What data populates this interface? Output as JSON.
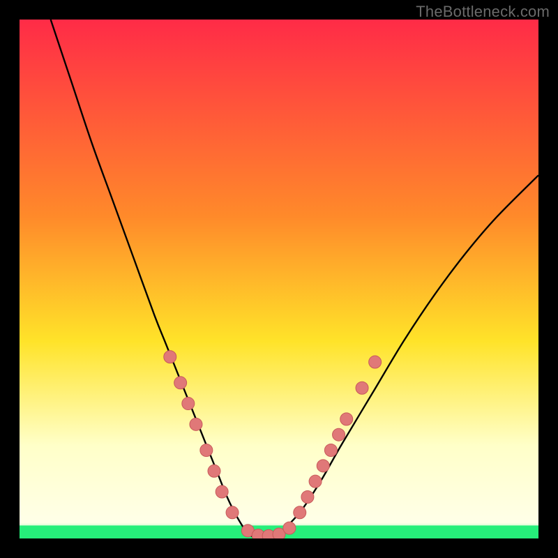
{
  "watermark": "TheBottleneck.com",
  "colors": {
    "frame": "#000000",
    "curve": "#000000",
    "dot_fill": "#e07878",
    "dot_stroke": "#c75a5a",
    "green_band": "#26ef7a",
    "gradient_top": "#ff2b47",
    "gradient_mid1": "#ff8a2a",
    "gradient_mid2": "#ffe329",
    "gradient_light": "#ffffc8",
    "gradient_bottom": "#26ef7a"
  },
  "chart_data": {
    "type": "line",
    "title": "",
    "xlabel": "",
    "ylabel": "",
    "xlim": [
      0,
      100
    ],
    "ylim": [
      0,
      100
    ],
    "grid": false,
    "legend": false,
    "series": [
      {
        "name": "bottleneck-curve",
        "x": [
          6,
          10,
          14,
          18,
          22,
          26,
          28,
          30,
          32,
          34,
          36,
          38,
          40,
          42,
          44,
          46,
          48,
          50,
          54,
          58,
          62,
          68,
          74,
          80,
          86,
          92,
          100
        ],
        "y": [
          100,
          88,
          76,
          65,
          54,
          43,
          38,
          33,
          28,
          23,
          18,
          13,
          8,
          4,
          1,
          0,
          0,
          1,
          5,
          11,
          18,
          28,
          38,
          47,
          55,
          62,
          70
        ]
      }
    ],
    "highlight_dots": {
      "name": "sample-points",
      "radius_px": 9,
      "points": [
        {
          "x": 29,
          "y": 35
        },
        {
          "x": 31,
          "y": 30
        },
        {
          "x": 32.5,
          "y": 26
        },
        {
          "x": 34,
          "y": 22
        },
        {
          "x": 36,
          "y": 17
        },
        {
          "x": 37.5,
          "y": 13
        },
        {
          "x": 39,
          "y": 9
        },
        {
          "x": 41,
          "y": 5
        },
        {
          "x": 44,
          "y": 1.5
        },
        {
          "x": 46,
          "y": 0.6
        },
        {
          "x": 48,
          "y": 0.5
        },
        {
          "x": 50,
          "y": 0.8
        },
        {
          "x": 52,
          "y": 2
        },
        {
          "x": 54,
          "y": 5
        },
        {
          "x": 55.5,
          "y": 8
        },
        {
          "x": 57,
          "y": 11
        },
        {
          "x": 58.5,
          "y": 14
        },
        {
          "x": 60,
          "y": 17
        },
        {
          "x": 61.5,
          "y": 20
        },
        {
          "x": 63,
          "y": 23
        },
        {
          "x": 66,
          "y": 29
        },
        {
          "x": 68.5,
          "y": 34
        }
      ]
    },
    "green_band_y_range": [
      0,
      2.5
    ]
  }
}
